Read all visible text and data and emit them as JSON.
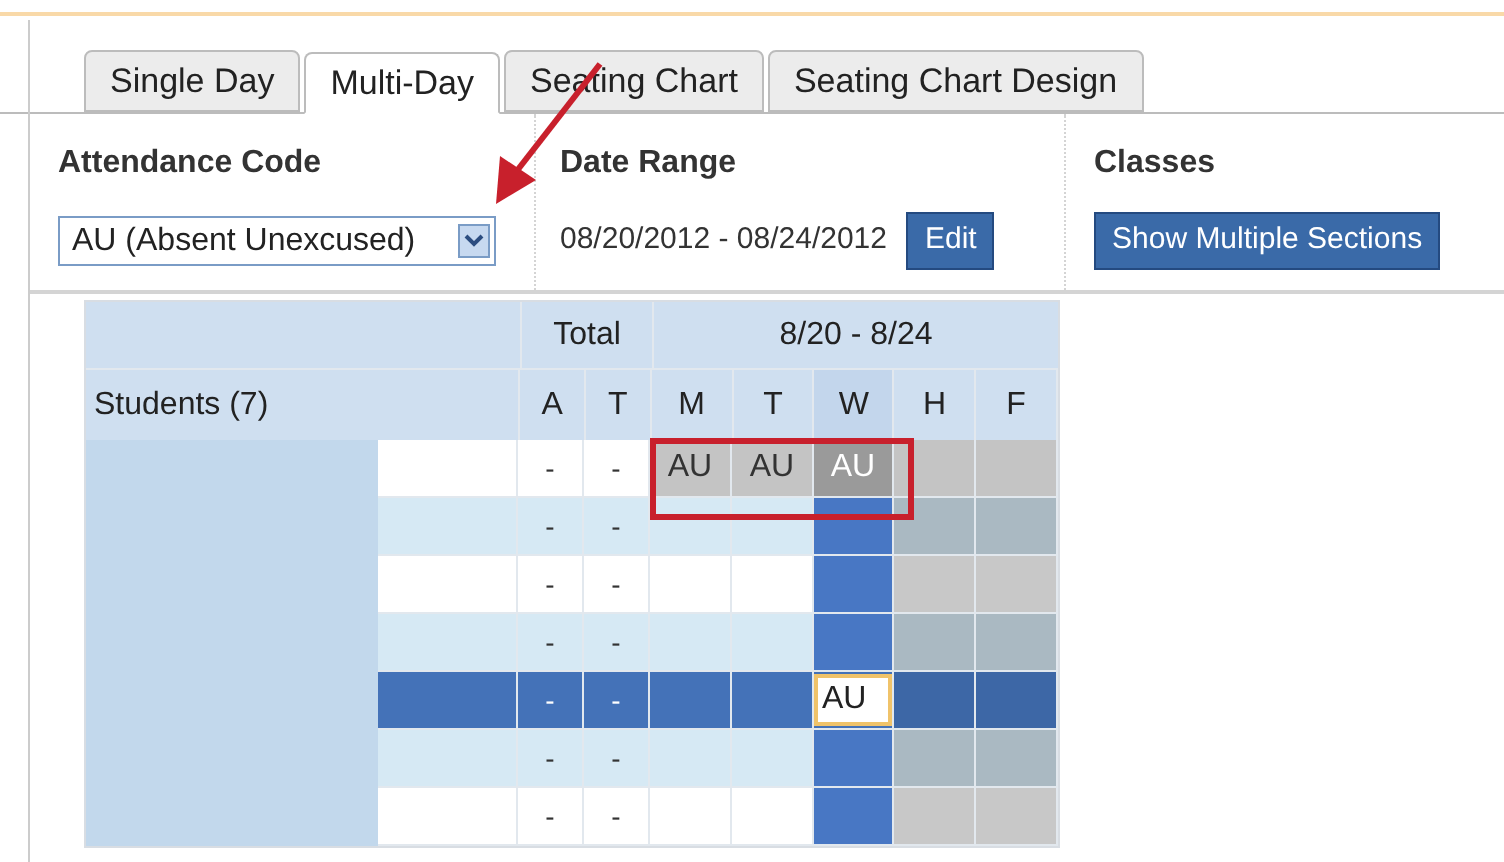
{
  "tabs": [
    {
      "label": "Single Day",
      "selected": false
    },
    {
      "label": "Multi-Day",
      "selected": true
    },
    {
      "label": "Seating Chart",
      "selected": false
    },
    {
      "label": "Seating Chart Design",
      "selected": false
    }
  ],
  "attendance_code": {
    "label": "Attendance Code",
    "value": "AU (Absent Unexcused)"
  },
  "date_range": {
    "label": "Date Range",
    "value": "08/20/2012 - 08/24/2012",
    "button": "Edit"
  },
  "classes": {
    "label": "Classes",
    "button": "Show Multiple Sections"
  },
  "table": {
    "total_header": "Total",
    "week_header": "8/20 - 8/24",
    "students_header": "Students (7)",
    "total_columns": [
      {
        "label": "A"
      },
      {
        "label": "T"
      }
    ],
    "day_columns": [
      {
        "label": "M",
        "selected": false
      },
      {
        "label": "T",
        "selected": false
      },
      {
        "label": "W",
        "selected": true
      },
      {
        "label": "H",
        "selected": false
      },
      {
        "label": "F",
        "selected": false
      }
    ],
    "rows": [
      {
        "selected": false,
        "totals": [
          "-",
          "-"
        ],
        "days": [
          {
            "kind": "preview",
            "text": "AU"
          },
          {
            "kind": "preview",
            "text": "AU"
          },
          {
            "kind": "preview",
            "text": "AU"
          },
          {
            "kind": "preview"
          },
          {
            "kind": "preview"
          }
        ]
      },
      {
        "selected": false,
        "totals": [
          "-",
          "-"
        ],
        "days": [
          {
            "kind": "plain"
          },
          {
            "kind": "plain"
          },
          {
            "kind": "plain"
          },
          {
            "kind": "future"
          },
          {
            "kind": "future"
          }
        ]
      },
      {
        "selected": false,
        "totals": [
          "-",
          "-"
        ],
        "days": [
          {
            "kind": "plain"
          },
          {
            "kind": "plain"
          },
          {
            "kind": "plain"
          },
          {
            "kind": "future"
          },
          {
            "kind": "future"
          }
        ]
      },
      {
        "selected": false,
        "totals": [
          "-",
          "-"
        ],
        "days": [
          {
            "kind": "plain"
          },
          {
            "kind": "plain"
          },
          {
            "kind": "plain"
          },
          {
            "kind": "future"
          },
          {
            "kind": "future"
          }
        ]
      },
      {
        "selected": true,
        "totals": [
          "-",
          "-"
        ],
        "days": [
          {
            "kind": "plain"
          },
          {
            "kind": "plain"
          },
          {
            "kind": "input",
            "text": "AU"
          },
          {
            "kind": "future"
          },
          {
            "kind": "future"
          }
        ]
      },
      {
        "selected": false,
        "totals": [
          "-",
          "-"
        ],
        "days": [
          {
            "kind": "plain"
          },
          {
            "kind": "plain"
          },
          {
            "kind": "plain"
          },
          {
            "kind": "future"
          },
          {
            "kind": "future"
          }
        ]
      },
      {
        "selected": false,
        "totals": [
          "-",
          "-"
        ],
        "days": [
          {
            "kind": "plain"
          },
          {
            "kind": "plain"
          },
          {
            "kind": "plain"
          },
          {
            "kind": "future"
          },
          {
            "kind": "future"
          }
        ]
      }
    ]
  }
}
